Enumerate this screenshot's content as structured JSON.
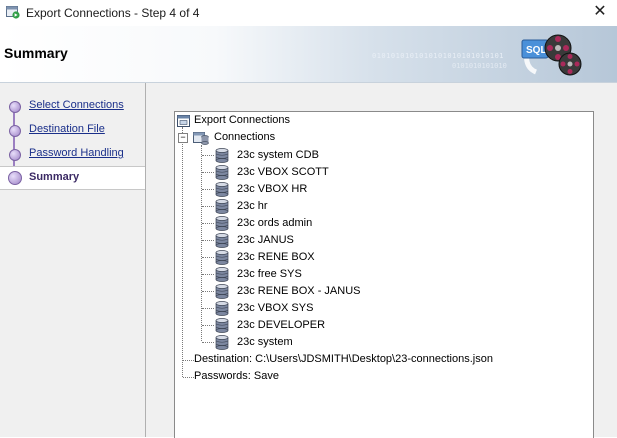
{
  "window": {
    "title": "Export Connections - Step 4 of 4",
    "close_glyph": "✕"
  },
  "header": {
    "title": "Summary",
    "binary_text_1": "0101010101010101010101010101",
    "binary_text_2": "0101010101010"
  },
  "steps": [
    {
      "label": "Select Connections",
      "current": false
    },
    {
      "label": "Destination File",
      "current": false
    },
    {
      "label": "Password Handling",
      "current": false
    },
    {
      "label": "Summary",
      "current": true
    }
  ],
  "tree": {
    "root_label": "Export Connections",
    "connections_label": "Connections",
    "connections": [
      "23c system CDB",
      "23c VBOX SCOTT",
      "23c VBOX HR",
      "23c hr",
      "23c ords admin",
      "23c JANUS",
      "23c RENE BOX",
      "23c free SYS",
      "23c RENE BOX - JANUS",
      "23c VBOX SYS",
      "23c DEVELOPER",
      "23c system"
    ],
    "destination_label": "Destination: C:\\Users\\JDSMITH\\Desktop\\23-connections.json",
    "passwords_label": "Passwords: Save",
    "collapse_glyph": "−"
  },
  "colors": {
    "link": "#1a2f8a",
    "current_step": "#3b2a64",
    "step_dot": "#9e83c6",
    "db_icon": "#7c87a0"
  },
  "icons": {
    "app": "export-wizard-icon",
    "logo": "sql-database-reels-logo",
    "tree_root": "export-window-icon",
    "connections": "connections-folder-icon",
    "connection": "database-cylinder-icon"
  }
}
